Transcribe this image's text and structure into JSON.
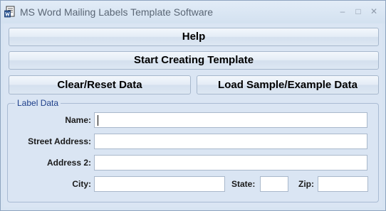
{
  "window": {
    "title": "MS Word Mailing Labels Template Software",
    "minimize_glyph": "–",
    "maximize_glyph": "□",
    "close_glyph": "✕"
  },
  "buttons": {
    "help": "Help",
    "start": "Start Creating Template",
    "clear": "Clear/Reset Data",
    "load": "Load Sample/Example Data"
  },
  "label_data": {
    "group_title": "Label Data",
    "name_label": "Name:",
    "name_value": "",
    "street_label": "Street Address:",
    "street_value": "",
    "address2_label": "Address 2:",
    "address2_value": "",
    "city_label": "City:",
    "city_value": "",
    "state_label": "State:",
    "state_value": "",
    "zip_label": "Zip:",
    "zip_value": ""
  },
  "icons": {
    "app": "word-document-icon"
  },
  "colors": {
    "background": "#dae5f3",
    "group_title": "#1e3f8a",
    "title_text": "#5a6675"
  }
}
